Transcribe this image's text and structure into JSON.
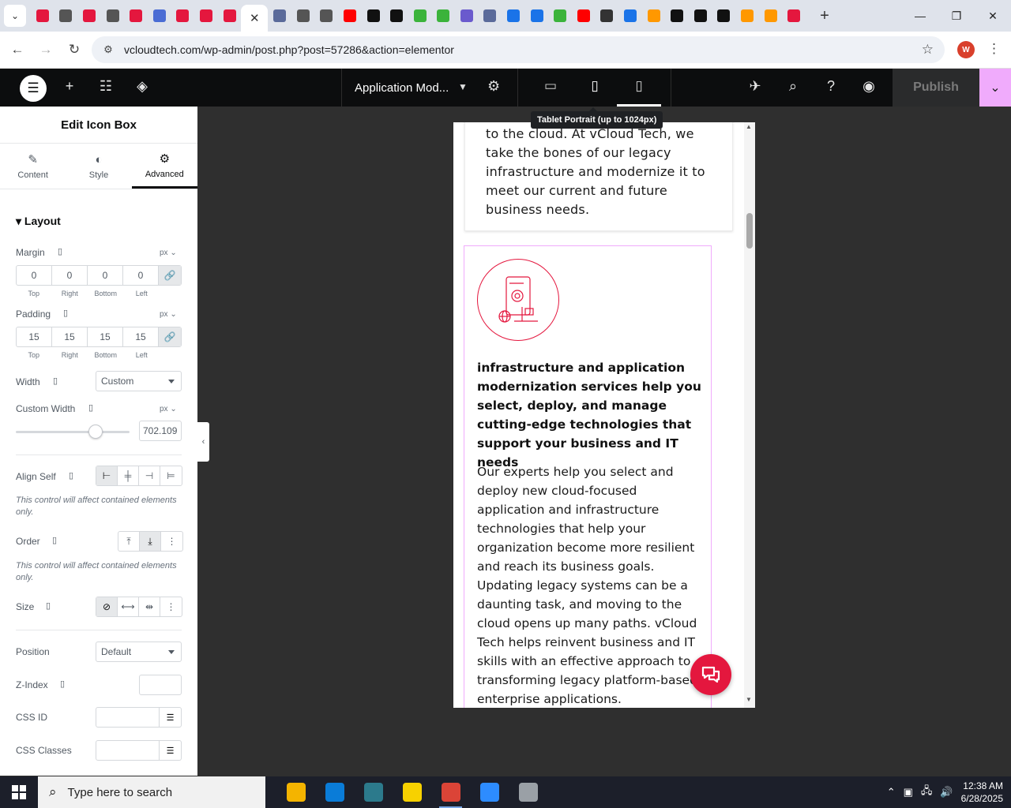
{
  "browser": {
    "tab_favicons": [
      {
        "name": "wordpress-red-icon",
        "color": "#e4173e"
      },
      {
        "name": "globe-icon",
        "color": "#555555"
      },
      {
        "name": "wordpress-red-icon",
        "color": "#e4173e"
      },
      {
        "name": "globe-icon",
        "color": "#555555"
      },
      {
        "name": "wordpress-red-icon",
        "color": "#e4173e"
      },
      {
        "name": "translate-icon",
        "color": "#4a6cd4"
      },
      {
        "name": "wordpress-red-icon",
        "color": "#e4173e"
      },
      {
        "name": "wordpress-red-icon",
        "color": "#e4173e"
      },
      {
        "name": "wordpress-red-icon",
        "color": "#e4173e"
      },
      {
        "name": "wordpress-red-icon",
        "color": "#e4173e"
      },
      {
        "name": "seo-icon",
        "color": "#5a6a9a"
      },
      {
        "name": "globe-icon",
        "color": "#555555"
      },
      {
        "name": "globe-icon",
        "color": "#555555"
      },
      {
        "name": "youtube-icon",
        "color": "#ff0000"
      },
      {
        "name": "threads-icon",
        "color": "#111111"
      },
      {
        "name": "threads-icon",
        "color": "#111111"
      },
      {
        "name": "bolt-green-icon",
        "color": "#3bb33b"
      },
      {
        "name": "bolt-green-icon",
        "color": "#3bb33b"
      },
      {
        "name": "gear-purple-icon",
        "color": "#6a5acd"
      },
      {
        "name": "seo-icon",
        "color": "#5a6a9a"
      },
      {
        "name": "grid-blue-icon",
        "color": "#1a73e8"
      },
      {
        "name": "grid-blue-icon",
        "color": "#1a73e8"
      },
      {
        "name": "bolt-green-icon",
        "color": "#3bb33b"
      },
      {
        "name": "youtube-icon",
        "color": "#ff0000"
      },
      {
        "name": "lock-icon",
        "color": "#333333"
      },
      {
        "name": "wifi-icon",
        "color": "#1a73e8"
      },
      {
        "name": "ring-icon",
        "color": "#ff9800"
      },
      {
        "name": "x-icon",
        "color": "#111111"
      },
      {
        "name": "x-icon",
        "color": "#111111"
      },
      {
        "name": "notion-icon",
        "color": "#111111"
      },
      {
        "name": "ring-icon",
        "color": "#ff9800"
      },
      {
        "name": "ring-icon",
        "color": "#ff9800"
      },
      {
        "name": "pen-red-icon",
        "color": "#e4173e"
      }
    ],
    "active_tab_index": 9,
    "url": "vcloudtech.com/wp-admin/post.php?post=57286&action=elementor",
    "profile_initial": "W"
  },
  "editor": {
    "document_title": "Application Mod...",
    "publish_label": "Publish",
    "tooltip": "Tablet Portrait (up to 1024px)"
  },
  "panel": {
    "title": "Edit Icon Box",
    "tabs": [
      {
        "label": "Content",
        "icon": "pencil-icon"
      },
      {
        "label": "Style",
        "icon": "half-circle-icon"
      },
      {
        "label": "Advanced",
        "icon": "gear-icon"
      }
    ],
    "section": "Layout",
    "margin": {
      "label": "Margin",
      "unit": "px",
      "values": [
        "0",
        "0",
        "0",
        "0"
      ]
    },
    "padding": {
      "label": "Padding",
      "unit": "px",
      "values": [
        "15",
        "15",
        "15",
        "15"
      ]
    },
    "dim_labels": [
      "Top",
      "Right",
      "Bottom",
      "Left"
    ],
    "width": {
      "label": "Width",
      "value": "Custom"
    },
    "custom_width": {
      "label": "Custom Width",
      "unit": "px",
      "value": "702.109",
      "slider_fraction": 0.7
    },
    "align_self": {
      "label": "Align Self",
      "note": "This control will affect contained elements only."
    },
    "order": {
      "label": "Order",
      "note": "This control will affect contained elements only."
    },
    "size": {
      "label": "Size"
    },
    "position": {
      "label": "Position",
      "value": "Default"
    },
    "z_index": {
      "label": "Z-Index"
    },
    "css_id": {
      "label": "CSS ID"
    },
    "css_classes": {
      "label": "CSS Classes"
    }
  },
  "preview": {
    "card1_text": "to the cloud. At vCloud Tech, we take the bones of our legacy infrastructure and modernize it to meet our current and future business needs.",
    "card2_heading": "infrastructure and application modernization services help you select, deploy, and manage cutting-edge technologies that support your business and IT needs",
    "card2_body": "Our experts help you select and deploy new cloud-focused application and infrastructure technologies that help your organization become more resilient and reach its business goals. Updating legacy systems can be a daunting task, and moving to the cloud opens up many paths. vCloud Tech helps reinvent business and IT skills with an effective approach to transforming legacy platform-based enterprise applications.",
    "accent_color": "#e4173e"
  },
  "taskbar": {
    "search_placeholder": "Type here to search",
    "apps": [
      {
        "name": "file-explorer-icon",
        "color": "#f4b400"
      },
      {
        "name": "edge-icon",
        "color": "#0a7cd8"
      },
      {
        "name": "app-diamond-icon",
        "color": "#2c7a8c"
      },
      {
        "name": "sticky-notes-icon",
        "color": "#f7d100"
      },
      {
        "name": "chrome-icon",
        "color": "#db4437"
      },
      {
        "name": "zoom-icon",
        "color": "#2d8cff"
      },
      {
        "name": "snipping-icon",
        "color": "#9aa0a6"
      }
    ],
    "time": "12:38 AM",
    "date": "6/28/2025"
  }
}
